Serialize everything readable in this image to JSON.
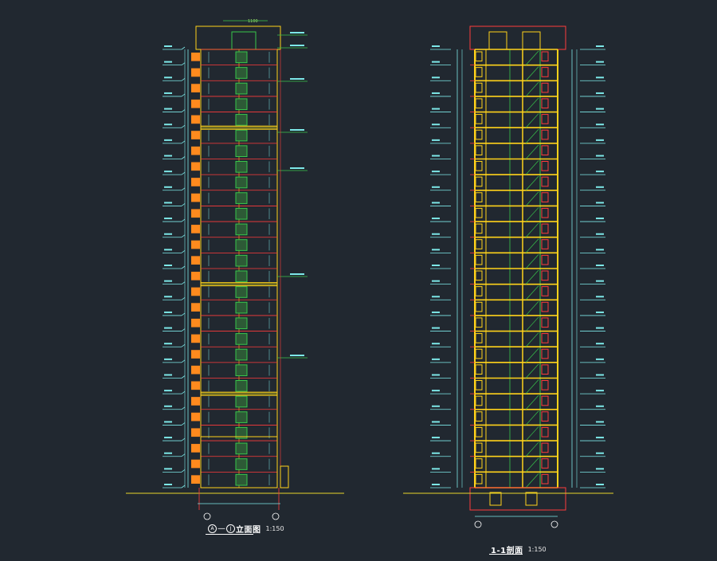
{
  "left_drawing": {
    "axis_a": "A",
    "axis_b": "J",
    "dash": "—",
    "title_suffix": "立面图",
    "scale": "1:150",
    "top_note": "1100"
  },
  "right_drawing": {
    "title": "1-1剖面",
    "scale": "1:150"
  },
  "palette": {
    "background": "#212830",
    "level_line": "#ff3b3b",
    "outline": "#ffd21a",
    "glazing": "#38c64a",
    "dimension": "#7de8e8",
    "balcony": "#ff8a1e",
    "ground": "#e6d42a"
  },
  "floors": 28
}
